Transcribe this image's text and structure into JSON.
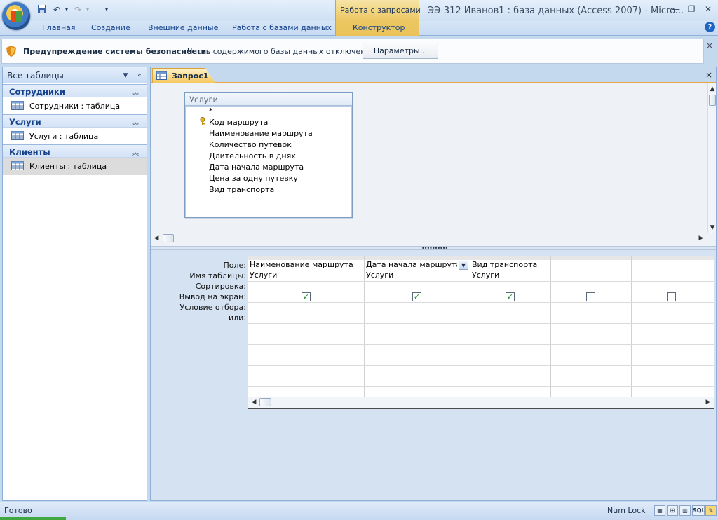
{
  "window": {
    "title": "ЭЭ-312 Иванов1 : база данных (Access 2007) - Micro...",
    "contextual_tab_group": "Работа с запросами"
  },
  "ribbon": {
    "tabs": [
      {
        "label": "Главная"
      },
      {
        "label": "Создание"
      },
      {
        "label": "Внешние данные"
      },
      {
        "label": "Работа с базами данных"
      },
      {
        "label": "Конструктор"
      }
    ],
    "help": "?"
  },
  "security_bar": {
    "title": "Предупреждение системы безопасности",
    "message": "Часть содержимого базы данных отключено",
    "button": "Параметры...",
    "close": "×"
  },
  "nav_pane": {
    "title": "Все таблицы",
    "groups": [
      {
        "label": "Сотрудники",
        "item": "Сотрудники : таблица"
      },
      {
        "label": "Услуги",
        "item": "Услуги : таблица"
      },
      {
        "label": "Клиенты",
        "item": "Клиенты : таблица",
        "selected": true
      }
    ]
  },
  "document": {
    "tab_label": "Запрос1",
    "close": "×"
  },
  "field_list": {
    "title": "Услуги",
    "fields": [
      "*",
      "Код маршрута",
      "Наименование маршрута",
      "Количество путевок",
      "Длительность в днях",
      "Дата начала маршрута",
      "Цена за одну путевку",
      "Вид транспорта"
    ],
    "key_field_index": 1
  },
  "query_grid": {
    "row_labels": [
      "Поле:",
      "Имя таблицы:",
      "Сортировка:",
      "Вывод на экран:",
      "Условие отбора:",
      "или:"
    ],
    "columns": [
      {
        "field": "Наименование маршрута",
        "table": "Услуги",
        "show": true
      },
      {
        "field": "Дата начала маршрута",
        "table": "Услуги",
        "show": true,
        "has_dropdown": true
      },
      {
        "field": "Вид транспорта",
        "table": "Услуги",
        "show": true
      },
      {
        "field": "",
        "table": "",
        "show": false
      },
      {
        "field": "",
        "table": "",
        "show": false
      }
    ]
  },
  "status_bar": {
    "status": "Готово",
    "numlock": "Num Lock",
    "view_buttons": [
      "datasheet-view",
      "pivot-view",
      "SQL",
      "design-view"
    ],
    "sql_label": "SQL"
  },
  "colors": {
    "ribbon_text": "#15428b",
    "contextual_tab": "#ecc660",
    "check_green": "#1f8a2a"
  }
}
